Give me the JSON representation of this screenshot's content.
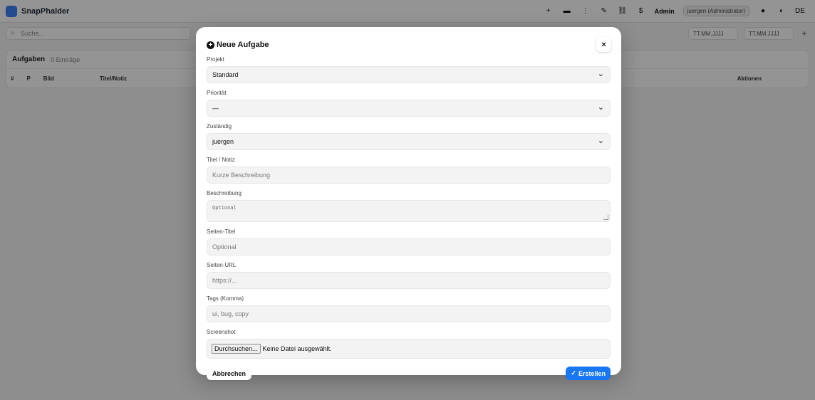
{
  "background": {
    "brand": "SnapPhalder",
    "admin_label": "Admin",
    "user_label": "juergen (Administrator)",
    "search_placeholder": "Suche...",
    "date_from": "TT.MM.JJJJ",
    "date_to": "TT.MM.JJJJ",
    "card_title": "Aufgaben",
    "card_count": "0 Einträge",
    "columns": [
      "#",
      "P",
      "Bild",
      "Titel/Notiz",
      "Aktionen"
    ]
  },
  "modal": {
    "title": "Neue Aufgabe",
    "close_glyph": "×",
    "fields": {
      "projekt": {
        "label": "Projekt",
        "value": "Standard"
      },
      "prioritaet": {
        "label": "Priorität",
        "value": "—"
      },
      "zustaendig": {
        "label": "Zuständig",
        "value": "juergen"
      },
      "titel": {
        "label": "Titel / Notiz",
        "placeholder": "Kurze Beschreibung"
      },
      "beschreibung": {
        "label": "Beschreibung",
        "placeholder": "Optional"
      },
      "seiten_titel": {
        "label": "Seiten-Titel",
        "placeholder": "Optional"
      },
      "seiten_url": {
        "label": "Seiten-URL",
        "placeholder": "https://..."
      },
      "tags": {
        "label": "Tags (Komma)",
        "placeholder": "ui, bug, copy"
      },
      "screenshot": {
        "label": "Screenshot",
        "button": "Durchsuchen...",
        "status": "Keine Datei ausgewählt."
      }
    },
    "cancel_label": "Abbrechen",
    "submit_label": "Erstellen"
  },
  "colors": {
    "accent": "#1877f2",
    "overlay": "rgba(0,0,0,0.42)",
    "field_bg": "#f3f3f3"
  }
}
